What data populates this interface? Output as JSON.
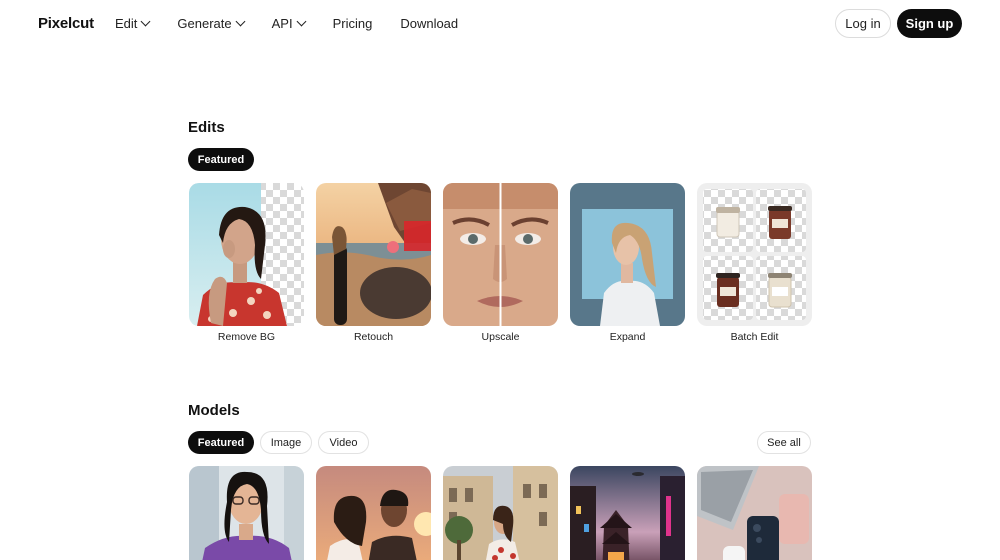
{
  "header": {
    "logo": "Pixelcut",
    "nav": [
      {
        "label": "Edit",
        "has_dropdown": true
      },
      {
        "label": "Generate",
        "has_dropdown": true
      },
      {
        "label": "API",
        "has_dropdown": true
      },
      {
        "label": "Pricing",
        "has_dropdown": false
      },
      {
        "label": "Download",
        "has_dropdown": false
      }
    ],
    "login_label": "Log in",
    "signup_label": "Sign up"
  },
  "edits": {
    "title": "Edits",
    "filter_active": "Featured",
    "cards": [
      {
        "label": "Remove BG"
      },
      {
        "label": "Retouch"
      },
      {
        "label": "Upscale"
      },
      {
        "label": "Expand"
      },
      {
        "label": "Batch Edit"
      }
    ]
  },
  "models": {
    "title": "Models",
    "filters": [
      "Featured",
      "Image",
      "Video"
    ],
    "see_all_label": "See all"
  },
  "colors": {
    "accent": "#0d0d0d",
    "pill_border": "#e2e2e2"
  }
}
